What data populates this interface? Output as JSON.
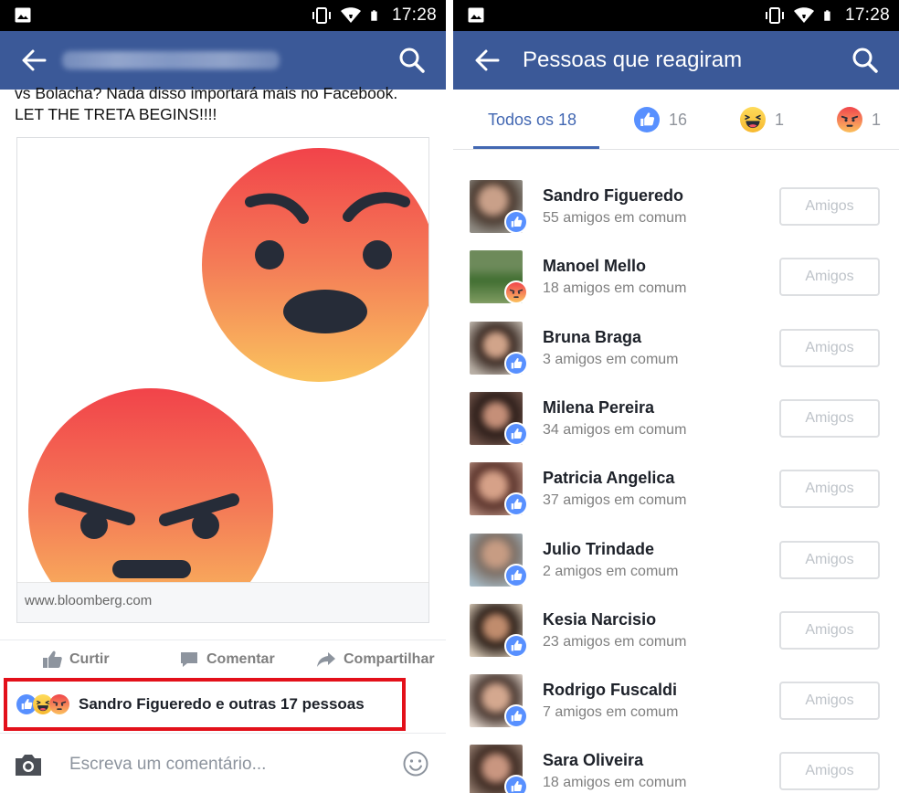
{
  "status_bar": {
    "time": "17:28"
  },
  "left": {
    "post_text_line1": "vs Bolacha? Nada disso importará mais no Facebook.",
    "post_text_line2": "LET THE TRETA BEGINS!!!!",
    "link_domain": "www.bloomberg.com",
    "actions": {
      "like": "Curtir",
      "comment": "Comentar",
      "share": "Compartilhar"
    },
    "reactions_summary": "Sandro Figueredo e outras 17 pessoas",
    "comment_placeholder": "Escreva um comentário..."
  },
  "right": {
    "title": "Pessoas que reagiram",
    "tabs": [
      {
        "label": "Todos os 18",
        "icon": "all"
      },
      {
        "label": "16",
        "icon": "like-icon"
      },
      {
        "label": "1",
        "icon": "haha-icon"
      },
      {
        "label": "1",
        "icon": "angry-icon"
      }
    ],
    "people": [
      {
        "name": "Sandro Figueredo",
        "mutual": "55 amigos em comum",
        "reaction": "like",
        "button": "Amigos"
      },
      {
        "name": "Manoel Mello",
        "mutual": "18 amigos em comum",
        "reaction": "angry",
        "button": "Amigos"
      },
      {
        "name": "Bruna Braga",
        "mutual": "3 amigos em comum",
        "reaction": "like",
        "button": "Amigos"
      },
      {
        "name": "Milena Pereira",
        "mutual": "34 amigos em comum",
        "reaction": "like",
        "button": "Amigos"
      },
      {
        "name": "Patricia Angelica",
        "mutual": "37 amigos em comum",
        "reaction": "like",
        "button": "Amigos"
      },
      {
        "name": "Julio Trindade",
        "mutual": "2 amigos em comum",
        "reaction": "like",
        "button": "Amigos"
      },
      {
        "name": "Kesia Narcisio",
        "mutual": "23 amigos em comum",
        "reaction": "like",
        "button": "Amigos"
      },
      {
        "name": "Rodrigo Fuscaldi",
        "mutual": "7 amigos em comum",
        "reaction": "like",
        "button": "Amigos"
      },
      {
        "name": "Sara Oliveira",
        "mutual": "18 amigos em comum",
        "reaction": "like",
        "button": "Amigos"
      }
    ]
  },
  "colors": {
    "facebook_blue": "#3b5998",
    "tab_active": "#4267b2",
    "highlight_red": "#e3101a",
    "like_blue": "#5890ff"
  }
}
